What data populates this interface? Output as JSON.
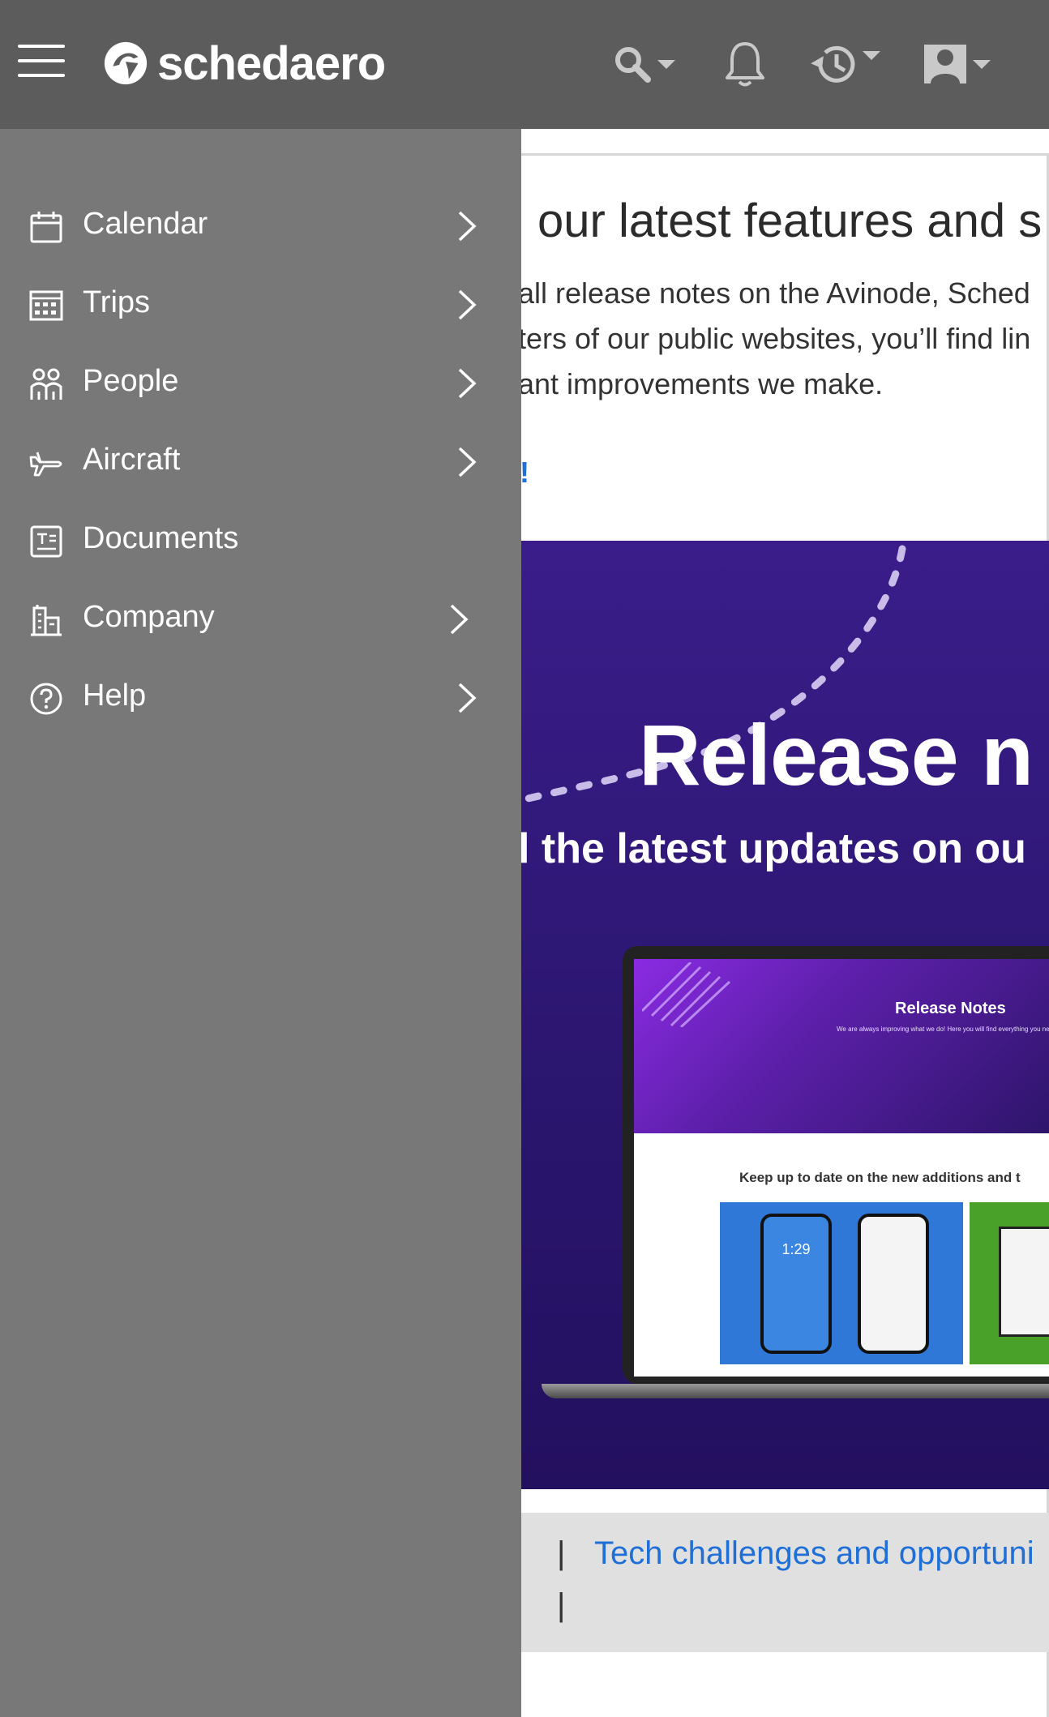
{
  "app": {
    "brand": "schedaero"
  },
  "colors": {
    "topbar": "#5c5c5c",
    "sidenav": "#787878",
    "link": "#1f6fd6",
    "banner": "#2b1670"
  },
  "topbar_icons": [
    "hamburger-icon",
    "search-icon",
    "bell-icon",
    "history-icon",
    "user-avatar-icon"
  ],
  "nav": {
    "items": [
      {
        "label": "Calendar",
        "icon": "calendar-icon",
        "has_submenu": true
      },
      {
        "label": "Trips",
        "icon": "trips-grid-icon",
        "has_submenu": true
      },
      {
        "label": "People",
        "icon": "people-icon",
        "has_submenu": true
      },
      {
        "label": "Aircraft",
        "icon": "aircraft-icon",
        "has_submenu": true
      },
      {
        "label": "Documents",
        "icon": "documents-icon",
        "has_submenu": false
      },
      {
        "label": "Company",
        "icon": "company-building-icon",
        "has_submenu": true
      },
      {
        "label": "Help",
        "icon": "help-icon",
        "has_submenu": true
      }
    ]
  },
  "content": {
    "heading": "our latest features and s",
    "para_line1": "all release notes on the Avinode, Sched",
    "para_line2": "ters of our public websites, you’ll find lin",
    "para_line3": "ant improvements we make.",
    "link_fragment": "!",
    "banner_title": "Release n",
    "banner_subtitle": "l the latest updates on ou",
    "laptop_screen_title": "Release Notes",
    "laptop_screen_subtitle": "We are always improving what we do! Here you will find everything you need to stay updated with our software",
    "laptop_keep_text": "Keep up to date on the new additions and t",
    "laptop_phone_time": "1:29",
    "footer_pipe_1": "|",
    "footer_pipe_2": "|",
    "footer_link": "Tech challenges and opportuni"
  }
}
